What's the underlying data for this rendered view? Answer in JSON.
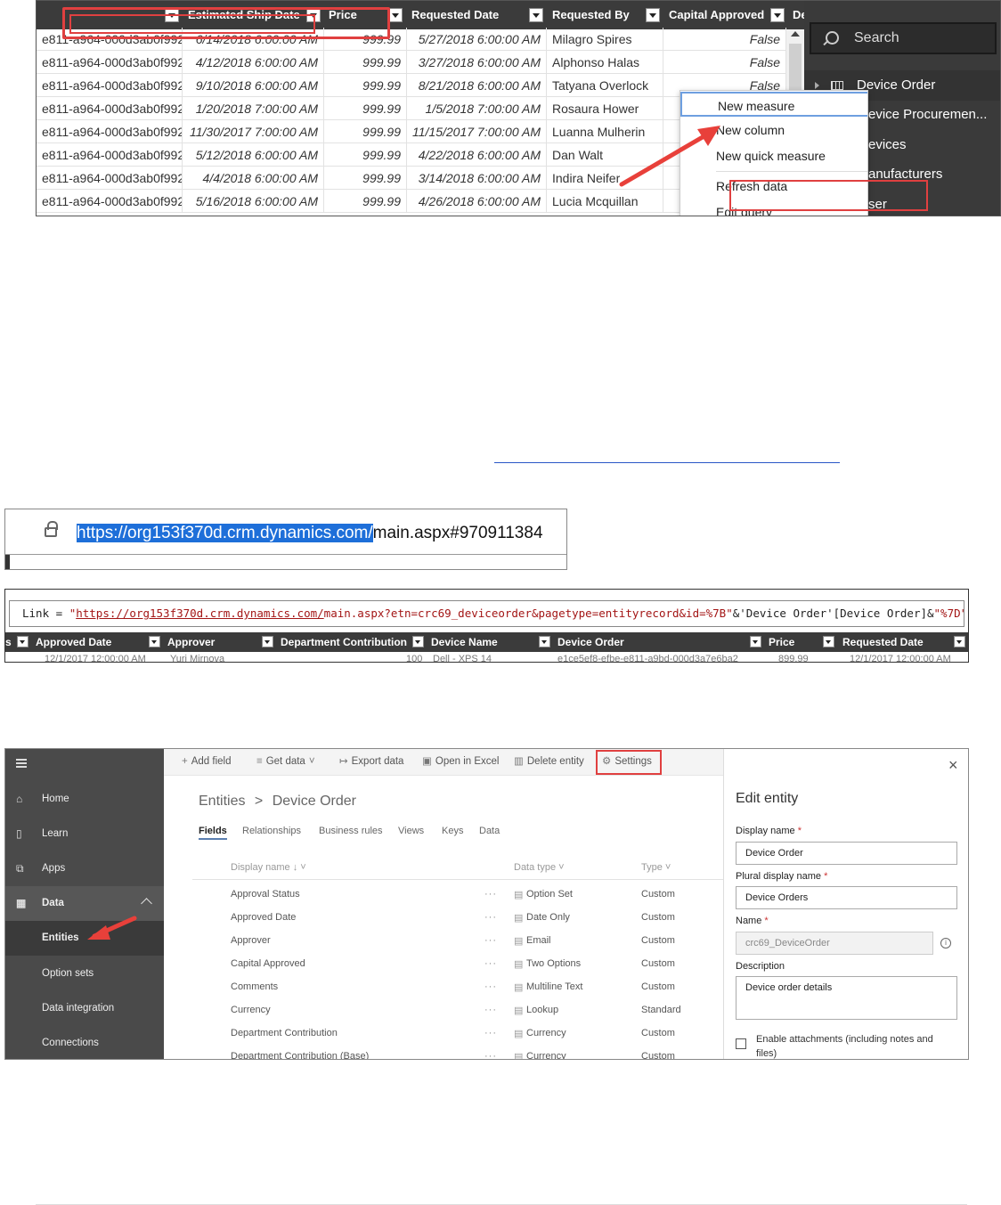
{
  "shot1": {
    "columns": [
      {
        "label": ""
      },
      {
        "label": "Estimated Ship Date"
      },
      {
        "label": "Price"
      },
      {
        "label": "Requested Date"
      },
      {
        "label": "Requested By"
      },
      {
        "label": "Capital Approved"
      },
      {
        "label": "De"
      }
    ],
    "rows": [
      [
        "e811-a964-000d3ab0f992",
        "6/14/2018 6:00:00 AM",
        "999.99",
        "5/27/2018 6:00:00 AM",
        "Milagro Spires",
        "False"
      ],
      [
        "e811-a964-000d3ab0f992",
        "4/12/2018 6:00:00 AM",
        "999.99",
        "3/27/2018 6:00:00 AM",
        "Alphonso Halas",
        "False"
      ],
      [
        "e811-a964-000d3ab0f992",
        "9/10/2018 6:00:00 AM",
        "999.99",
        "8/21/2018 6:00:00 AM",
        "Tatyana Overlock",
        "False"
      ],
      [
        "e811-a964-000d3ab0f992",
        "1/20/2018 7:00:00 AM",
        "999.99",
        "1/5/2018 7:00:00 AM",
        "Rosaura Hower",
        ""
      ],
      [
        "e811-a964-000d3ab0f992",
        "11/30/2017 7:00:00 AM",
        "999.99",
        "11/15/2017 7:00:00 AM",
        "Luanna Mulherin",
        ""
      ],
      [
        "e811-a964-000d3ab0f992",
        "5/12/2018 6:00:00 AM",
        "999.99",
        "4/22/2018 6:00:00 AM",
        "Dan Walt",
        ""
      ],
      [
        "e811-a964-000d3ab0f992",
        "4/4/2018 6:00:00 AM",
        "999.99",
        "3/14/2018 6:00:00 AM",
        "Indira Neifer",
        ""
      ],
      [
        "e811-a964-000d3ab0f992",
        "5/16/2018 6:00:00 AM",
        "999.99",
        "4/26/2018 6:00:00 AM",
        "Lucia Mcquillan",
        ""
      ]
    ],
    "search_placeholder": "Search",
    "fields": [
      "Device Order",
      "evice Procuremen...",
      "evices",
      "anufacturers",
      "ser"
    ],
    "context_menu": [
      "New measure",
      "New column",
      "New quick measure",
      "Refresh data",
      "Edit query"
    ],
    "annotation_color": "#e8403a"
  },
  "shot2": {
    "url_highlighted": "https://org153f370d.crm.dynamics.com/",
    "url_rest": "main.aspx#970911384",
    "highlight_color": "#1e6fd9"
  },
  "shot3": {
    "formula": {
      "name": "Link = ",
      "q1": "\"",
      "url": "https://org153f370d.crm.dynamics.com/",
      "rest": "main.aspx?etn=crc69_deviceorder&pagetype=entityrecord&id=%7B\"",
      "mid": "&'Device Order'[Device Order]&",
      "end": "\"%7D\""
    },
    "columns": [
      "s",
      "Approved Date",
      "Approver",
      "Department Contribution",
      "Device Name",
      "Device Order",
      "Price",
      "Requested Date"
    ],
    "row_partial": [
      "12/1/2017 12:00:00 AM",
      "Yuri Mirnova",
      "100",
      "Dell - XPS 14",
      "e1ce5ef8-efbe-e811-a9bd-000d3a7e6ba2",
      "899.99",
      "12/1/2017 12:00:00 AM"
    ]
  },
  "shot4": {
    "nav": {
      "home": "Home",
      "learn": "Learn",
      "apps": "Apps",
      "data": "Data",
      "entities": "Entities",
      "option_sets": "Option sets",
      "data_integration": "Data integration",
      "connections": "Connections"
    },
    "commands": {
      "add_field": "Add field",
      "get_data": "Get data",
      "export_data": "Export data",
      "open_in_excel": "Open in Excel",
      "delete_entity": "Delete entity",
      "settings": "Settings"
    },
    "breadcrumb": {
      "root": "Entities",
      "sep": ">",
      "current": "Device Order"
    },
    "tabs": [
      "Fields",
      "Relationships",
      "Business rules",
      "Views",
      "Keys",
      "Data"
    ],
    "headers": {
      "display_name": "Display name ↓",
      "data_type": "Data type",
      "type": "Type"
    },
    "fields": [
      {
        "name": "Approval Status",
        "data_type": "Option Set",
        "type": "Custom"
      },
      {
        "name": "Approved Date",
        "data_type": "Date Only",
        "type": "Custom"
      },
      {
        "name": "Approver",
        "data_type": "Email",
        "type": "Custom"
      },
      {
        "name": "Capital Approved",
        "data_type": "Two Options",
        "type": "Custom"
      },
      {
        "name": "Comments",
        "data_type": "Multiline Text",
        "type": "Custom"
      },
      {
        "name": "Currency",
        "data_type": "Lookup",
        "type": "Standard"
      },
      {
        "name": "Department Contribution",
        "data_type": "Currency",
        "type": "Custom"
      },
      {
        "name": "Department Contribution (Base)",
        "data_type": "Currency",
        "type": "Custom"
      }
    ],
    "panel": {
      "title": "Edit entity",
      "display_name_label": "Display name",
      "display_name_value": "Device Order",
      "plural_label": "Plural display name",
      "plural_value": "Device Orders",
      "name_label": "Name",
      "name_value": "crc69_DeviceOrder",
      "description_label": "Description",
      "description_value": "Device order details",
      "attachments_label": "Enable attachments (including notes and files)",
      "required_mark": "*"
    }
  }
}
